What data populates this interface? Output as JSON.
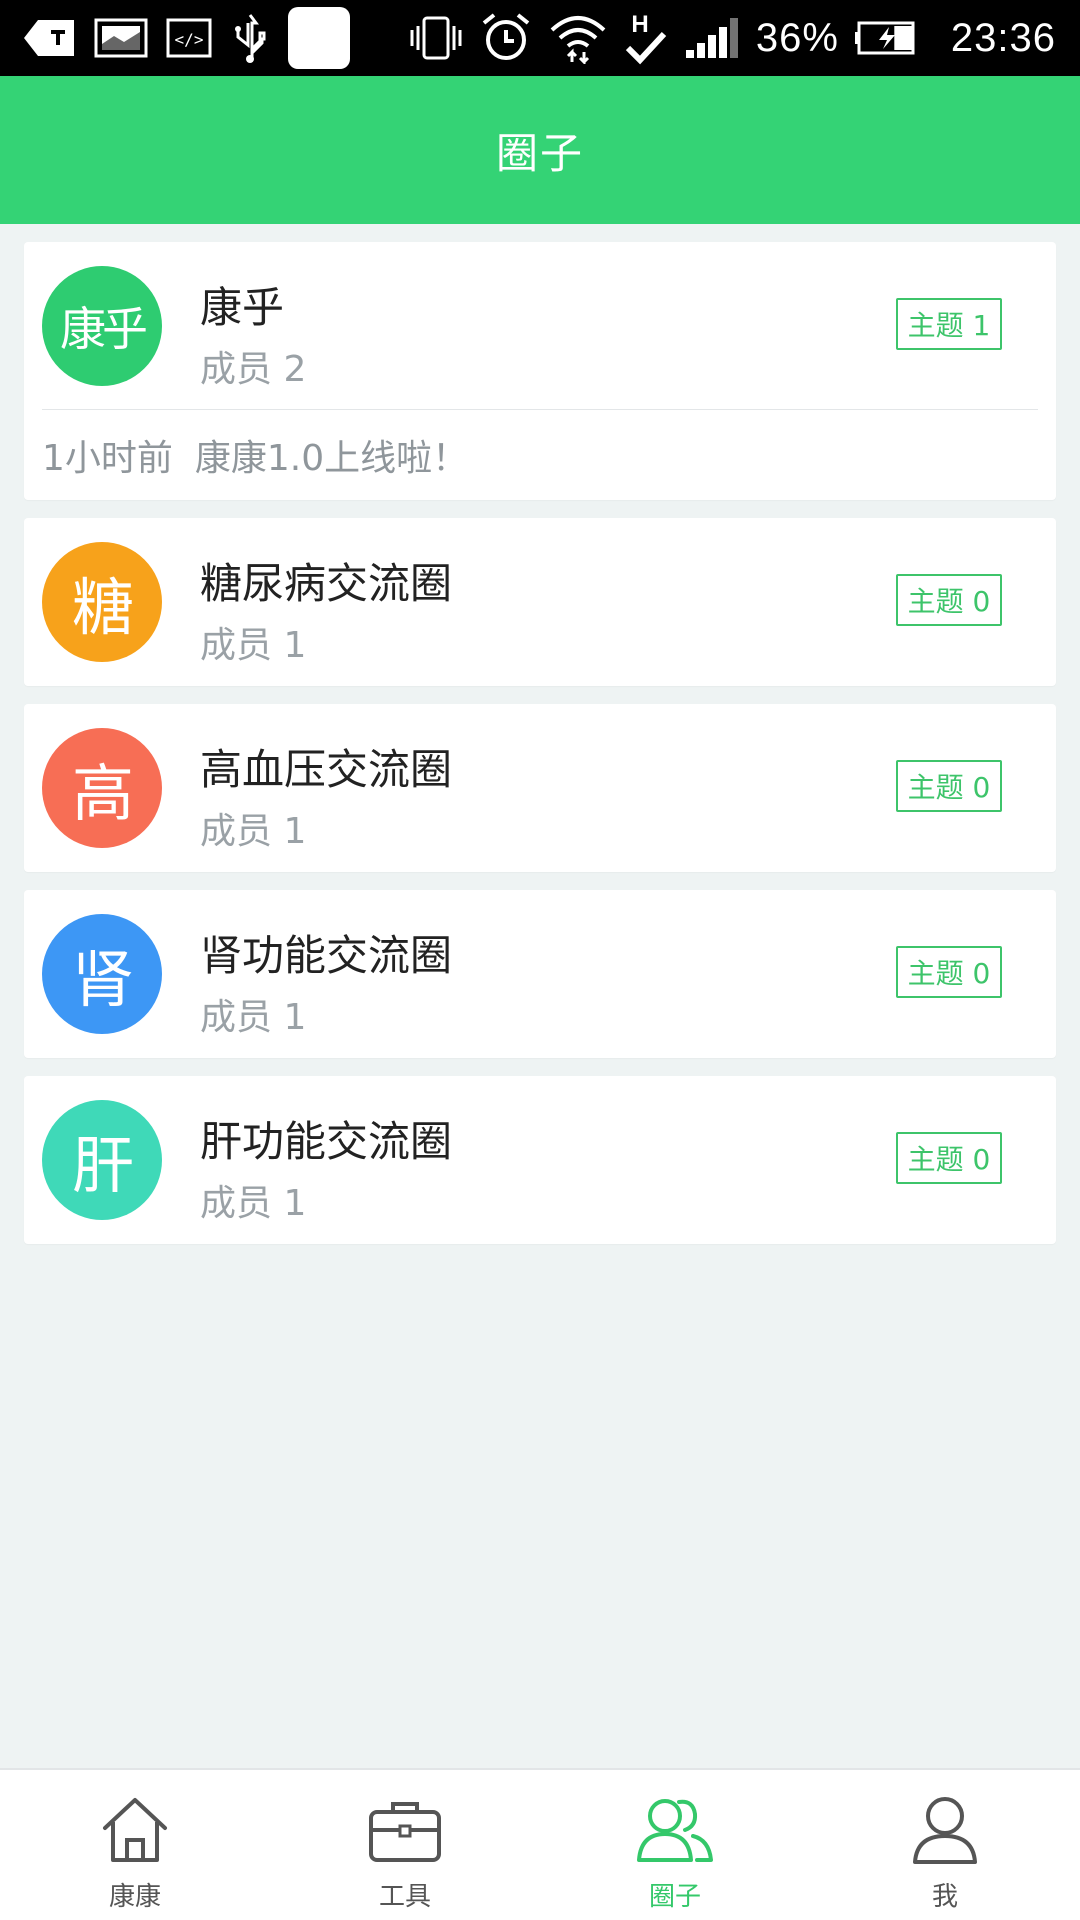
{
  "status_bar": {
    "battery_text": "36%",
    "time": "23:36",
    "network_label": "H",
    "battery_level": 0.36
  },
  "header": {
    "title": "圈子"
  },
  "circles": [
    {
      "avatar_text": "康乎",
      "avatar_color": "#2ecc71",
      "name": "康乎",
      "members": "成员 2",
      "topics": "主题 1",
      "latest_time": "1小时前",
      "latest_text": "康康1.0上线啦！"
    },
    {
      "avatar_text": "糖",
      "avatar_color": "#f7a21b",
      "name": "糖尿病交流圈",
      "members": "成员 1",
      "topics": "主题 0"
    },
    {
      "avatar_text": "高",
      "avatar_color": "#f76e55",
      "name": "高血压交流圈",
      "members": "成员 1",
      "topics": "主题 0"
    },
    {
      "avatar_text": "肾",
      "avatar_color": "#3d97f5",
      "name": "肾功能交流圈",
      "members": "成员 1",
      "topics": "主题 0"
    },
    {
      "avatar_text": "肝",
      "avatar_color": "#3fd9b8",
      "name": "肝功能交流圈",
      "members": "成员 1",
      "topics": "主题 0"
    }
  ],
  "nav": {
    "items": [
      {
        "label": "康康",
        "icon": "home-icon"
      },
      {
        "label": "工具",
        "icon": "briefcase-icon"
      },
      {
        "label": "圈子",
        "icon": "group-icon"
      },
      {
        "label": "我",
        "icon": "person-icon"
      }
    ],
    "active_index": 2,
    "active_color": "#34c86a",
    "inactive_color": "#555555"
  },
  "colors": {
    "brand_green": "#34d375",
    "badge_green": "#3dc46a",
    "background": "#eef3f3"
  }
}
